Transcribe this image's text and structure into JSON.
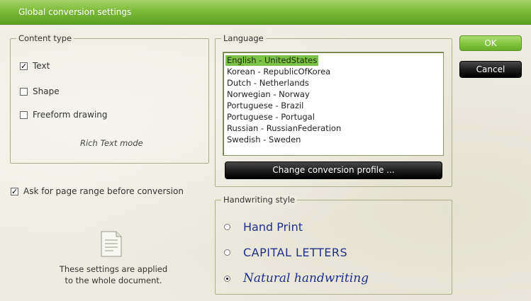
{
  "window": {
    "title": "Global conversion settings"
  },
  "content_type": {
    "legend": "Content type",
    "options": [
      {
        "label": "Text",
        "checked": true
      },
      {
        "label": "Shape",
        "checked": false
      },
      {
        "label": "Freeform drawing",
        "checked": false
      }
    ],
    "mode_note": "Rich Text mode"
  },
  "ask_page_range": {
    "label": "Ask for page range before conversion",
    "checked": true
  },
  "info": {
    "line1": "These settings are applied",
    "line2": "to the whole document."
  },
  "language": {
    "legend": "Language",
    "items": [
      "English - UnitedStates",
      "Korean - RepublicOfKorea",
      "Dutch - Netherlands",
      "Norwegian - Norway",
      "Portuguese - Brazil",
      "Portuguese - Portugal",
      "Russian - RussianFederation",
      "Swedish - Sweden"
    ],
    "selected": "English - UnitedStates",
    "change_profile_label": "Change conversion profile ..."
  },
  "handwriting": {
    "legend": "Handwriting style",
    "options": [
      {
        "label": "Hand Print",
        "selected": false
      },
      {
        "label": "CAPITAL LETTERS",
        "selected": false
      },
      {
        "label": "Natural handwriting",
        "selected": true
      }
    ]
  },
  "buttons": {
    "ok": "OK",
    "cancel": "Cancel"
  },
  "colors": {
    "accent_green": "#7cbb3a",
    "dark_button": "#1a1a1a",
    "handwriting_blue": "#1f2f8a"
  }
}
